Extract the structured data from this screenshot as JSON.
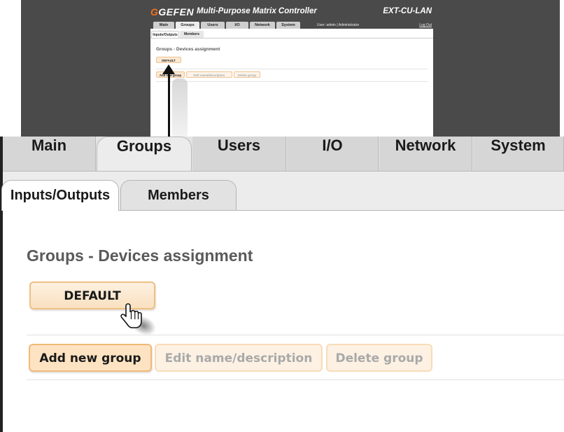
{
  "thumbnail": {
    "logo_text": "GEFEN",
    "app_title": "Multi-Purpose Matrix Controller",
    "model": "EXT-CU-LAN",
    "nav_tabs": [
      "Main",
      "Groups",
      "Users",
      "I/O",
      "Network",
      "System"
    ],
    "active_tab": "Groups",
    "user_info": "User: admin  |  Administrator",
    "logout": "Log Out",
    "sub_tabs": [
      "Inputs/Outputs",
      "Members"
    ],
    "heading": "Groups - Devices assignment",
    "group_button": "DEFAULT",
    "actions": [
      "Add new group",
      "Edit name/description",
      "Delete group"
    ]
  },
  "nav": {
    "tabs": [
      {
        "label": "Main"
      },
      {
        "label": "Groups"
      },
      {
        "label": "Users"
      },
      {
        "label": "I/O"
      },
      {
        "label": "Network"
      },
      {
        "label": "System"
      }
    ],
    "active": "Groups"
  },
  "subnav": {
    "tabs": [
      {
        "label": "Inputs/Outputs"
      },
      {
        "label": "Members"
      }
    ],
    "active": "Inputs/Outputs"
  },
  "page": {
    "title": "Groups - Devices assignment",
    "groups": [
      {
        "label": "DEFAULT"
      }
    ],
    "actions": {
      "add_label": "Add new group",
      "edit_label": "Edit name/description",
      "delete_label": "Delete group"
    }
  },
  "colors": {
    "button_fill": "#fdecd6",
    "button_border": "#f4cc98",
    "thumbnail_bg": "#4a4a4a",
    "brand_accent": "#f07020"
  },
  "icons": [
    "hand-pointer-cursor-icon",
    "callout-arrow-icon",
    "gefen-logo-icon"
  ]
}
